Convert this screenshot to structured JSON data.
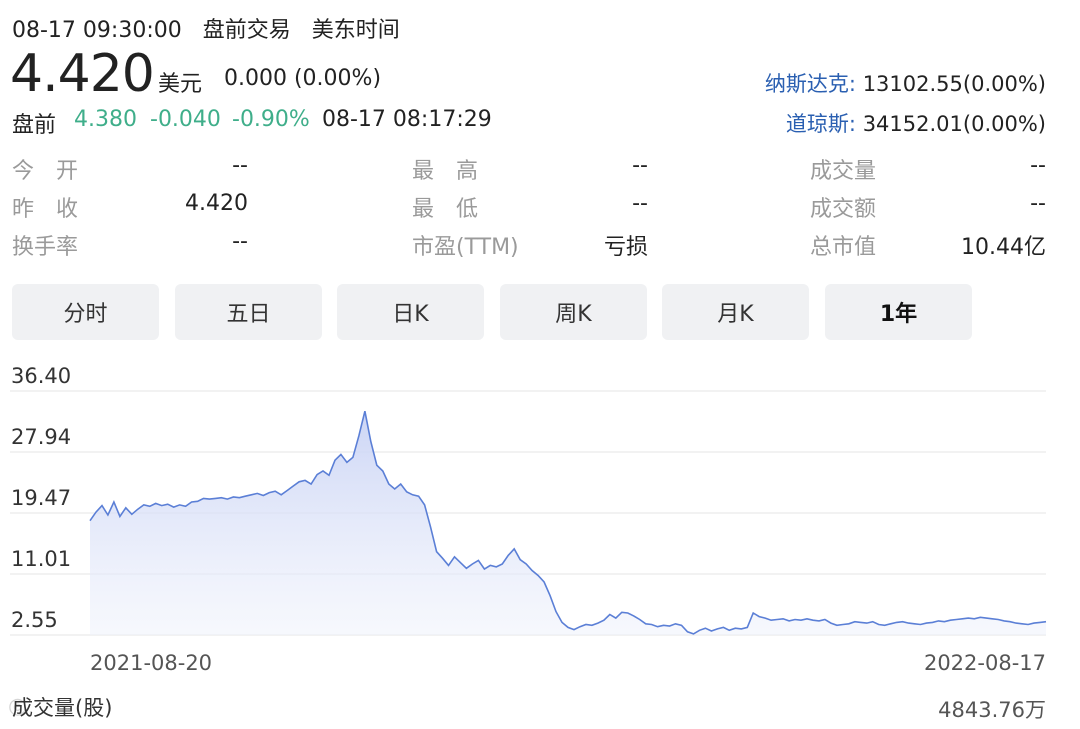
{
  "header": {
    "datetime": "08-17 09:30:00",
    "session": "盘前交易",
    "timezone": "美东时间"
  },
  "quote": {
    "price": "4.420",
    "currency": "美元",
    "change": "0.000 (0.00%)",
    "premarket": {
      "label": "盘前",
      "price": "4.380",
      "change": "-0.040",
      "pct": "-0.90%",
      "time": "08-17 08:17:29"
    }
  },
  "indices": [
    {
      "name": "纳斯达克:",
      "value": "13102.55(0.00%)"
    },
    {
      "name": "道琼斯:",
      "value": "34152.01(0.00%)"
    }
  ],
  "stats": [
    {
      "label": "今　开",
      "value": "--"
    },
    {
      "label": "最　高",
      "value": "--"
    },
    {
      "label": "成交量",
      "value": "--"
    },
    {
      "label": "昨　收",
      "value": "4.420"
    },
    {
      "label": "最　低",
      "value": "--"
    },
    {
      "label": "成交额",
      "value": "--"
    },
    {
      "label": "换手率",
      "value": "--"
    },
    {
      "label": "市盈(TTM)",
      "value": "亏损"
    },
    {
      "label": "总市值",
      "value": "10.44亿"
    }
  ],
  "tabs": [
    {
      "label": "分时",
      "active": false
    },
    {
      "label": "五日",
      "active": false
    },
    {
      "label": "日K",
      "active": false
    },
    {
      "label": "周K",
      "active": false
    },
    {
      "label": "月K",
      "active": false
    },
    {
      "label": "1年",
      "active": true
    }
  ],
  "colors": {
    "line": "#5b7fd6",
    "fill_top": "#dfe5f8",
    "up_green": "#3fae8a",
    "index_blue": "#2a5fb1"
  },
  "chart_data": {
    "type": "area",
    "y_ticks": [
      "36.40",
      "27.94",
      "19.47",
      "11.01",
      "2.55"
    ],
    "ylim": [
      2.55,
      36.4
    ],
    "x_labels": [
      "2021-08-20",
      "2022-08-17"
    ],
    "grid": true,
    "values": [
      18.4,
      19.6,
      20.5,
      19.2,
      21.0,
      19.0,
      20.2,
      19.3,
      20.0,
      20.6,
      20.4,
      20.8,
      20.5,
      20.7,
      20.3,
      20.6,
      20.4,
      21.0,
      21.1,
      21.5,
      21.4,
      21.5,
      21.6,
      21.4,
      21.7,
      21.6,
      21.8,
      22.0,
      22.2,
      21.9,
      22.3,
      22.5,
      22.0,
      22.6,
      23.2,
      23.8,
      24.0,
      23.5,
      24.8,
      25.3,
      24.7,
      26.8,
      27.6,
      26.5,
      27.2,
      30.2,
      33.6,
      29.4,
      26.1,
      25.3,
      23.5,
      22.8,
      23.5,
      22.4,
      22.0,
      21.8,
      20.6,
      17.5,
      14.1,
      13.2,
      12.2,
      13.4,
      12.6,
      11.8,
      12.4,
      12.9,
      11.7,
      12.2,
      12.0,
      12.4,
      13.6,
      14.5,
      13.0,
      12.4,
      11.5,
      10.8,
      9.9,
      8.0,
      5.8,
      4.3,
      3.6,
      3.3,
      3.7,
      4.0,
      3.9,
      4.2,
      4.6,
      5.4,
      4.9,
      5.7,
      5.6,
      5.2,
      4.7,
      4.1,
      4.0,
      3.7,
      3.9,
      3.8,
      4.1,
      3.9,
      3.0,
      2.7,
      3.2,
      3.5,
      3.1,
      3.4,
      3.6,
      3.2,
      3.5,
      3.4,
      3.6,
      5.6,
      5.1,
      4.9,
      4.6,
      4.7,
      4.8,
      4.5,
      4.7,
      4.6,
      4.8,
      4.6,
      4.5,
      4.7,
      4.2,
      3.9,
      4.0,
      4.1,
      4.4,
      4.3,
      4.2,
      4.4,
      4.0,
      3.9,
      4.1,
      4.3,
      4.4,
      4.2,
      4.1,
      4.0,
      4.2,
      4.3,
      4.5,
      4.4,
      4.6,
      4.7,
      4.8,
      4.9,
      4.8,
      5.0,
      4.9,
      4.8,
      4.7,
      4.5,
      4.4,
      4.2,
      4.1,
      4.0,
      4.2,
      4.3,
      4.4
    ]
  },
  "volume": {
    "label": "成交量(股)",
    "value": "4843.76万"
  }
}
